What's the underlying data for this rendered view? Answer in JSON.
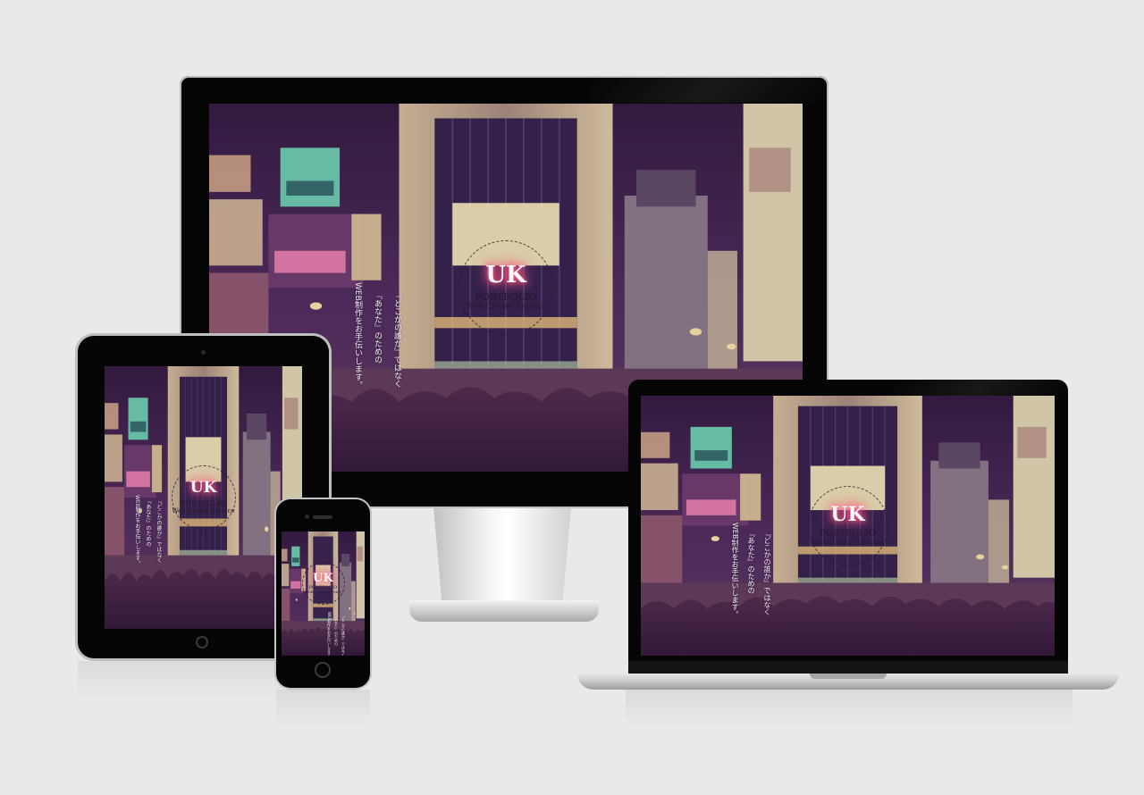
{
  "hero": {
    "logo_mark": "UK",
    "logo_title": "PORTFOLIO",
    "logo_subtitle": "Web Create Service",
    "tagline_1": "『どこかの誰か』ではなく",
    "tagline_2": "『あなた』のための",
    "tagline_3": "WEB制作をお手伝いします。"
  },
  "devices": {
    "desktop": "desktop-monitor",
    "laptop": "laptop",
    "tablet": "tablet",
    "phone": "smartphone"
  },
  "colors": {
    "background": "#e9e9ea",
    "bezel": "#050505",
    "logo_glow": "#ff3f74",
    "scene_sky": "#3a1f4a"
  }
}
